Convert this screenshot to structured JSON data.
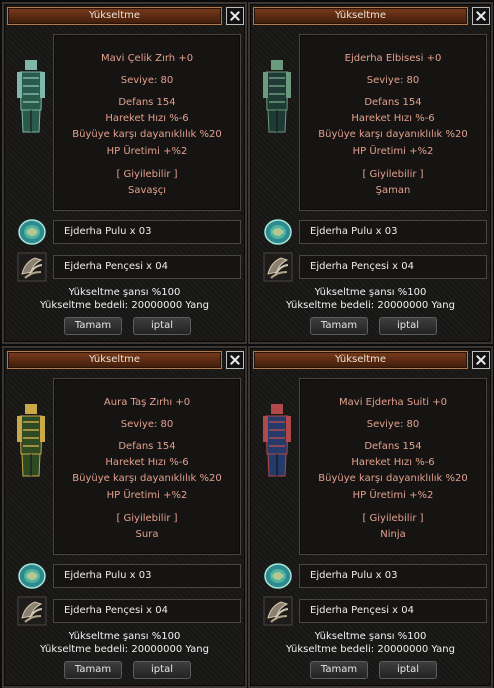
{
  "window_title": "Yükseltme",
  "panels": [
    {
      "item_name": "Mavi Çelik Zırh +0",
      "level": "Seviye: 80",
      "defense": "Defans 154",
      "move_speed": "Hareket Hızı %-6",
      "magic_resist": "Büyüye karşı dayanıklılık %20",
      "hp_regen": "HP Üretimi +%2",
      "wearable": "[ Giyilebilir ]",
      "class": "Savaşçı",
      "item_icon": "chest-armor-icon",
      "item_colors": {
        "main": "#2a5a4c",
        "accent": "#7fb8a8"
      }
    },
    {
      "item_name": "Ejderha Elbisesi +0",
      "level": "Seviye: 80",
      "defense": "Defans 154",
      "move_speed": "Hareket Hızı %-6",
      "magic_resist": "Büyüye karşı dayanıklılık %20",
      "hp_regen": "HP Üretimi +%2",
      "wearable": "[ Giyilebilir ]",
      "class": "Şaman",
      "item_icon": "dragon-robe-icon",
      "item_colors": {
        "main": "#1f3a34",
        "accent": "#6c9a7e"
      }
    },
    {
      "item_name": "Aura Taş Zırhı +0",
      "level": "Seviye: 80",
      "defense": "Defans 154",
      "move_speed": "Hareket Hızı %-6",
      "magic_resist": "Büyüye karşı dayanıklılık %20",
      "hp_regen": "HP Üretimi +%2",
      "wearable": "[ Giyilebilir ]",
      "class": "Sura",
      "item_icon": "aura-armor-icon",
      "item_colors": {
        "main": "#2d4a22",
        "accent": "#c9a84a"
      }
    },
    {
      "item_name": "Mavi Ejderha Suiti +0",
      "level": "Seviye: 80",
      "defense": "Defans 154",
      "move_speed": "Hareket Hızı %-6",
      "magic_resist": "Büyüye karşı dayanıklılık %20",
      "hp_regen": "HP Üretimi +%2",
      "wearable": "[ Giyilebilir ]",
      "class": "Ninja",
      "item_icon": "blue-suit-icon",
      "item_colors": {
        "main": "#243a6a",
        "accent": "#b04a4a"
      }
    }
  ],
  "materials": [
    {
      "label": "Ejderha Pulu x 03",
      "icon": "dragon-scale-icon"
    },
    {
      "label": "Ejderha Pençesi x 04",
      "icon": "dragon-claw-icon"
    }
  ],
  "chance": "Yükseltme şansı %100",
  "cost": "Yükseltme bedeli: 20000000 Yang",
  "buttons": {
    "ok": "Tamam",
    "cancel": "iptal"
  },
  "colors": {
    "title_bar": "#5a2a12",
    "stat_text": "#e3a08d",
    "window_bg": "#181716"
  }
}
